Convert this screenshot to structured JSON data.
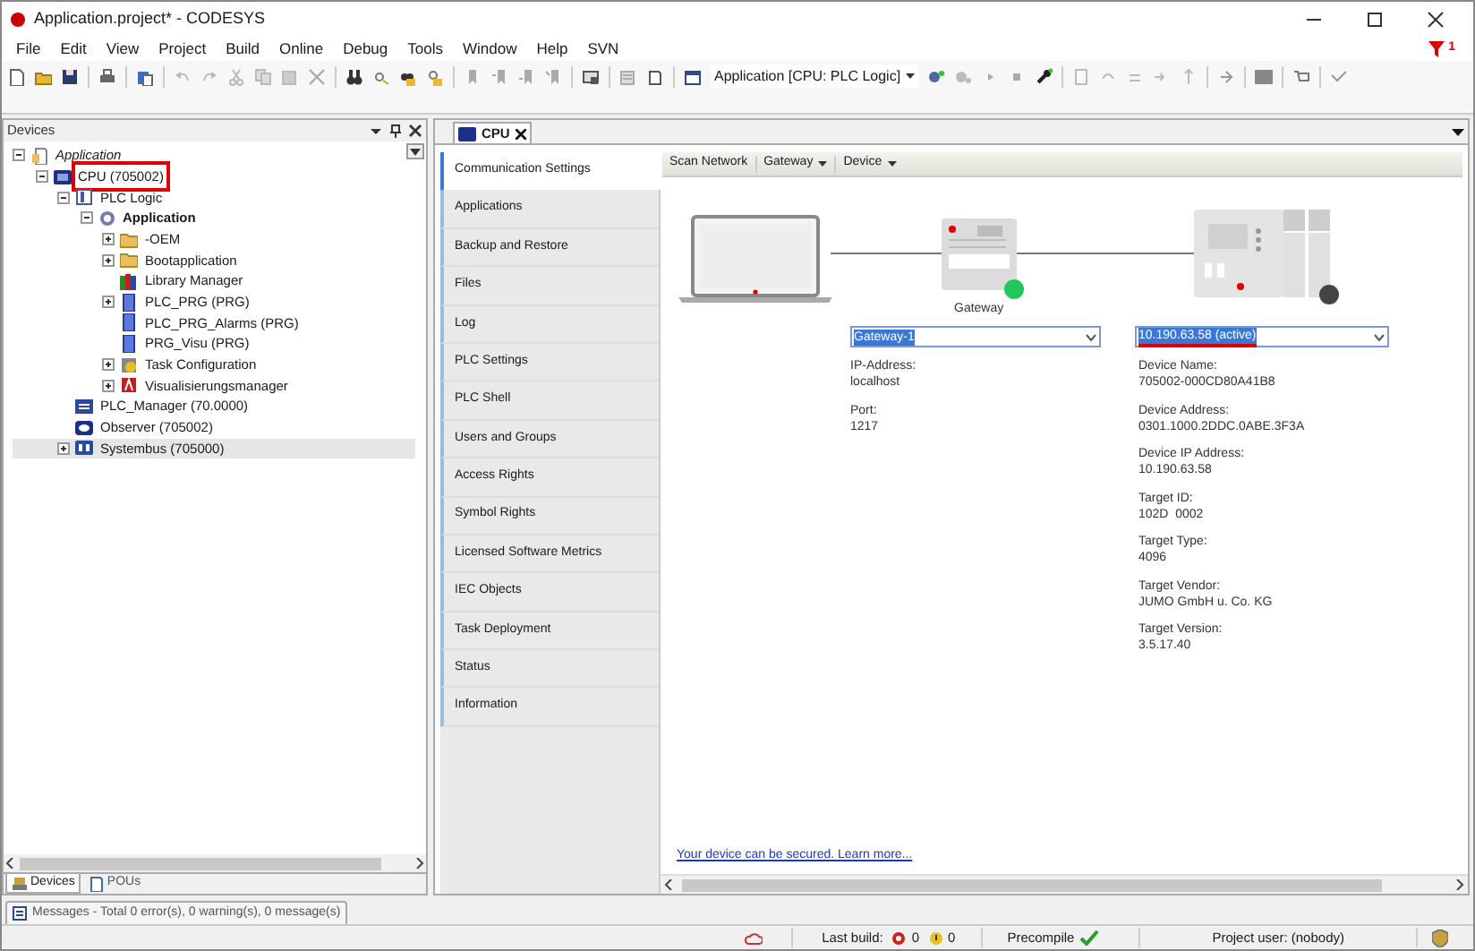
{
  "window": {
    "title": "Application.project* - CODESYS",
    "filter_count": "1"
  },
  "menu": [
    "File",
    "Edit",
    "View",
    "Project",
    "Build",
    "Online",
    "Debug",
    "Tools",
    "Window",
    "Help",
    "SVN"
  ],
  "toolbar": {
    "active_application": "Application [CPU: PLC Logic]"
  },
  "devices_panel": {
    "title": "Devices",
    "tree": [
      {
        "label": "Application",
        "kind": "project",
        "expanded": true,
        "selected": false,
        "children": [
          {
            "label": "CPU (705002)",
            "kind": "cpu",
            "highlighted": true,
            "expanded": true,
            "selected": false,
            "children": [
              {
                "label": "PLC Logic",
                "kind": "plc",
                "expanded": true,
                "selected": false,
                "children": [
                  {
                    "label": "Application",
                    "kind": "app",
                    "expanded": true,
                    "selected": false,
                    "children": [
                      {
                        "label": "-OEM",
                        "kind": "folder",
                        "expanded": false,
                        "selected": false
                      },
                      {
                        "label": "Bootapplication",
                        "kind": "folder",
                        "expanded": false,
                        "selected": false
                      },
                      {
                        "label": "Library Manager",
                        "kind": "library",
                        "selected": false
                      },
                      {
                        "label": "PLC_PRG (PRG)",
                        "kind": "pou",
                        "expanded": false,
                        "selected": false
                      },
                      {
                        "label": "PLC_PRG_Alarms (PRG)",
                        "kind": "pou",
                        "selected": false
                      },
                      {
                        "label": "PRG_Visu (PRG)",
                        "kind": "pou",
                        "selected": false
                      },
                      {
                        "label": "Task Configuration",
                        "kind": "task",
                        "expanded": false,
                        "selected": false
                      },
                      {
                        "label": "Visualisierungsmanager",
                        "kind": "visu",
                        "expanded": false,
                        "selected": false
                      }
                    ]
                  }
                ]
              },
              {
                "label": "PLC_Manager (70.0000)",
                "kind": "manager",
                "selected": false
              },
              {
                "label": "Observer (705002)",
                "kind": "observer",
                "selected": false
              },
              {
                "label": "Systembus (705000)",
                "kind": "bus",
                "expanded": false,
                "selected": true
              }
            ]
          }
        ]
      }
    ],
    "tabs": [
      {
        "label": "Devices",
        "selected": true
      },
      {
        "label": "POUs",
        "selected": false
      }
    ]
  },
  "editor": {
    "tab": "CPU",
    "nav": [
      {
        "label": "Communication Settings",
        "selected": true
      },
      {
        "label": "Applications",
        "selected": false
      },
      {
        "label": "Backup and Restore",
        "selected": false
      },
      {
        "label": "Files",
        "selected": false
      },
      {
        "label": "Log",
        "selected": false
      },
      {
        "label": "PLC Settings",
        "selected": false
      },
      {
        "label": "PLC Shell",
        "selected": false
      },
      {
        "label": "Users and Groups",
        "selected": false
      },
      {
        "label": "Access Rights",
        "selected": false
      },
      {
        "label": "Symbol Rights",
        "selected": false
      },
      {
        "label": "Licensed Software Metrics",
        "selected": false
      },
      {
        "label": "IEC Objects",
        "selected": false
      },
      {
        "label": "Task Deployment",
        "selected": false
      },
      {
        "label": "Status",
        "selected": false
      },
      {
        "label": "Information",
        "selected": false
      }
    ],
    "actions": [
      {
        "label": "Scan Network",
        "dropdown": false
      },
      {
        "label": "Gateway",
        "dropdown": true
      },
      {
        "label": "Device",
        "dropdown": true
      }
    ],
    "gateway": {
      "label": "Gateway",
      "color": "#22c55e",
      "value": "Gateway-1",
      "fields": [
        {
          "label": "IP-Address:",
          "value": "localhost"
        },
        {
          "label": "Port:",
          "value": "1217"
        }
      ]
    },
    "device": {
      "color": "#444444",
      "value": "10.190.63.58 (active)",
      "fields": [
        {
          "label": "Device Name:",
          "value": "705002-000CD80A41B8"
        },
        {
          "label": "Device Address:",
          "value": "0301.1000.2DDC.0ABE.3F3A"
        },
        {
          "label": "Device IP Address:",
          "value": "10.190.63.58"
        },
        {
          "label": "Target ID:",
          "value": "102D  0002"
        },
        {
          "label": "Target Type:",
          "value": "4096"
        },
        {
          "label": "Target Vendor:",
          "value": "JUMO GmbH u. Co. KG"
        },
        {
          "label": "Target Version:",
          "value": "3.5.17.40"
        }
      ]
    },
    "link": "Your device can be secured. Learn more..."
  },
  "messages_tab": "Messages - Total 0 error(s), 0 warning(s), 0 message(s)",
  "status_bar": {
    "last_build": "Last build:",
    "errors": "0",
    "warnings": "0",
    "precompile": "Precompile",
    "user": "Project user: (nobody)"
  }
}
